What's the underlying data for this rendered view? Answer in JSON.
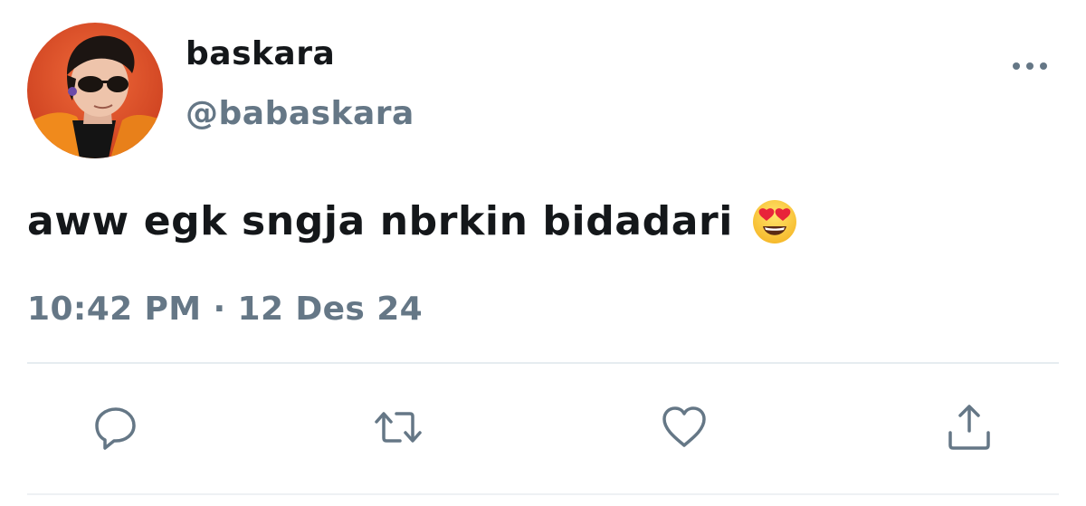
{
  "tweet": {
    "display_name": "baskara",
    "handle": "@babaskara",
    "text": "aww egk sngja nbrkin bidadari",
    "emoji": "smiling-face-with-heart-eyes",
    "time": "10:42 PM",
    "separator": "·",
    "date": "12 Des 24"
  },
  "actions": {
    "reply": "reply-icon",
    "retweet": "retweet-icon",
    "like": "heart-icon",
    "share": "share-icon",
    "more": "more-options-icon"
  },
  "colors": {
    "text_primary": "#14171a",
    "text_secondary": "#657786",
    "icon": "#657786",
    "divider": "#e6ecf0"
  }
}
